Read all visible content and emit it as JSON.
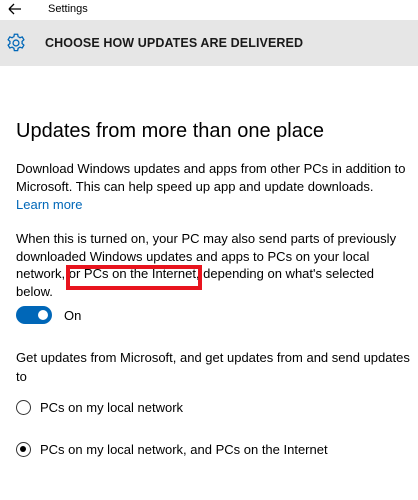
{
  "window": {
    "title": "Settings"
  },
  "header": {
    "title": "CHOOSE HOW UPDATES ARE DELIVERED",
    "icon": "gear-icon"
  },
  "section": {
    "title": "Updates from more than one place",
    "description": "Download Windows updates and apps from other PCs in addition to Microsoft. This can help speed up app and update downloads.",
    "learn_more": "Learn more",
    "detail": "When this is turned on, your PC may also send parts of previously downloaded Windows updates and apps to PCs on your local network, or PCs on the Internet, depending on what's selected below."
  },
  "toggle": {
    "state": "On",
    "is_on": true
  },
  "source": {
    "label": "Get updates from Microsoft, and get updates from and send updates to",
    "options": [
      {
        "label": "PCs on my local network",
        "selected": false
      },
      {
        "label": "PCs on my local network, and PCs on the Internet",
        "selected": true
      }
    ]
  },
  "colors": {
    "accent": "#0067b8",
    "highlight_box": "#e8141e",
    "header_bg": "#e6e6e6"
  }
}
